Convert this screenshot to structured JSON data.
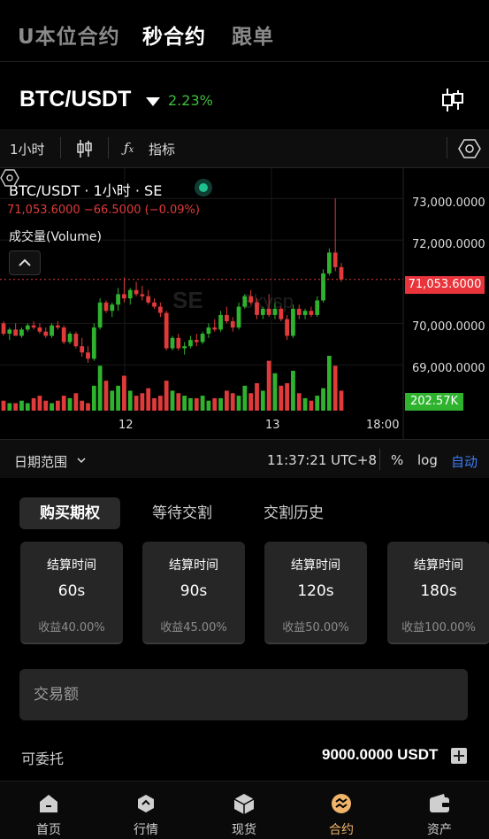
{
  "top_tabs": [
    {
      "label": "U本位合约"
    },
    {
      "label": "秒合约"
    },
    {
      "label": "跟单"
    }
  ],
  "pair": {
    "name": "BTC/USDT",
    "change": "2.23%",
    "change_color": "#3cbf3c"
  },
  "toolbar": {
    "interval": "1小时",
    "indicator_label": "指标"
  },
  "chart": {
    "title": "BTC/USDT · 1小时 · SE",
    "price_line": "71,053.6000  −66.5000 (−0.09%)",
    "volume_label": "成交量(Volume)",
    "y_ticks": [
      "73,000.0000",
      "72,000.0000",
      "71,053.6000",
      "70,000.0000",
      "69,000.0000"
    ],
    "current_price": "71,053.6000",
    "current_volume": "202.57K",
    "x_ticks": [
      "12",
      "13",
      "18:00"
    ],
    "up_color": "#2fb32f",
    "down_color": "#e03a3a"
  },
  "chart_data": {
    "type": "candlestick",
    "ylim": [
      68200,
      73600
    ],
    "y_ticks": [
      73000,
      72000,
      71053.6,
      70000,
      69000
    ],
    "x_ticks": [
      "12",
      "13",
      "18:00"
    ],
    "last_price": 71053.6,
    "last_volume": "202.57K",
    "candles": [
      [
        70000,
        70050,
        69700,
        69750
      ],
      [
        69750,
        69900,
        69600,
        69850
      ],
      [
        69850,
        70000,
        69700,
        69700
      ],
      [
        69700,
        69900,
        69650,
        69850
      ],
      [
        69850,
        70000,
        69800,
        69950
      ],
      [
        69950,
        70050,
        69850,
        69900
      ],
      [
        69900,
        70000,
        69750,
        69800
      ],
      [
        69800,
        69900,
        69650,
        69700
      ],
      [
        69700,
        70000,
        69650,
        69950
      ],
      [
        69950,
        70050,
        69850,
        69900
      ],
      [
        69900,
        69950,
        69500,
        69550
      ],
      [
        69550,
        69800,
        69500,
        69750
      ],
      [
        69750,
        69800,
        69400,
        69450
      ],
      [
        69450,
        69650,
        69200,
        69300
      ],
      [
        69300,
        69450,
        69050,
        69150
      ],
      [
        69150,
        70000,
        69100,
        69900
      ],
      [
        69900,
        70600,
        69850,
        70500
      ],
      [
        70500,
        70550,
        70250,
        70300
      ],
      [
        70300,
        70500,
        70150,
        70450
      ],
      [
        70450,
        70850,
        70300,
        70700
      ],
      [
        70700,
        71100,
        70500,
        70600
      ],
      [
        70600,
        70850,
        70450,
        70800
      ],
      [
        70800,
        71000,
        70650,
        70700
      ],
      [
        70700,
        70900,
        70550,
        70650
      ],
      [
        70650,
        70800,
        70450,
        70500
      ],
      [
        70500,
        70600,
        70350,
        70400
      ],
      [
        70400,
        70500,
        70150,
        70250
      ],
      [
        70250,
        70300,
        69350,
        69400
      ],
      [
        69400,
        69700,
        69350,
        69650
      ],
      [
        69650,
        69750,
        69350,
        69400
      ],
      [
        69400,
        69550,
        69250,
        69450
      ],
      [
        69450,
        69700,
        69400,
        69600
      ],
      [
        69600,
        69750,
        69450,
        69550
      ],
      [
        69550,
        69800,
        69500,
        69750
      ],
      [
        69750,
        70000,
        69650,
        69900
      ],
      [
        69900,
        70100,
        69800,
        69850
      ],
      [
        69850,
        70300,
        69800,
        70200
      ],
      [
        70200,
        70400,
        70000,
        70050
      ],
      [
        70050,
        70150,
        69800,
        69900
      ],
      [
        69900,
        70500,
        69850,
        70400
      ],
      [
        70400,
        70700,
        70350,
        70650
      ],
      [
        70650,
        70800,
        70450,
        70500
      ],
      [
        70500,
        70600,
        70100,
        70200
      ],
      [
        70200,
        70400,
        70100,
        70350
      ],
      [
        70350,
        70700,
        70150,
        70200
      ],
      [
        70200,
        70500,
        70100,
        70350
      ],
      [
        70350,
        70400,
        70050,
        70100
      ],
      [
        70100,
        70200,
        69600,
        69700
      ],
      [
        69700,
        70450,
        69650,
        70350
      ],
      [
        70350,
        70450,
        70100,
        70200
      ],
      [
        70200,
        70350,
        70100,
        70300
      ],
      [
        70300,
        70400,
        70150,
        70200
      ],
      [
        70200,
        70650,
        70150,
        70550
      ],
      [
        70550,
        71300,
        70500,
        71200
      ],
      [
        71200,
        71800,
        71150,
        71700
      ],
      [
        71700,
        73000,
        71250,
        71350
      ],
      [
        71350,
        71450,
        71000,
        71053.6
      ]
    ],
    "volumes": [
      4,
      3,
      3,
      4,
      3,
      5,
      6,
      4,
      3,
      4,
      6,
      5,
      7,
      4,
      3,
      10,
      18,
      12,
      8,
      10,
      14,
      8,
      6,
      7,
      9,
      5,
      6,
      12,
      8,
      7,
      6,
      5,
      5,
      6,
      4,
      5,
      5,
      8,
      7,
      6,
      10,
      7,
      11,
      8,
      20,
      15,
      10,
      11,
      16,
      7,
      5,
      4,
      6,
      9,
      22,
      18,
      8
    ]
  },
  "date_row": {
    "range_label": "日期范围",
    "time": "11:37:21 UTC+8",
    "percent": "%",
    "log": "log",
    "auto": "自动",
    "auto_color": "#3d7cf5"
  },
  "option_tabs": [
    {
      "label": "购买期权"
    },
    {
      "label": "等待交割"
    },
    {
      "label": "交割历史"
    }
  ],
  "cards": [
    {
      "label": "结算时间",
      "duration": "60s",
      "yield": "收益40.00%"
    },
    {
      "label": "结算时间",
      "duration": "90s",
      "yield": "收益45.00%"
    },
    {
      "label": "结算时间",
      "duration": "120s",
      "yield": "收益50.00%"
    },
    {
      "label": "结算时间",
      "duration": "180s",
      "yield": "收益100.00%"
    }
  ],
  "amount": {
    "placeholder": "交易额",
    "value": ""
  },
  "available": {
    "label": "可委托",
    "value": "9000.0000 USDT"
  },
  "bottom_nav": [
    {
      "label": "首页",
      "icon": "home-icon"
    },
    {
      "label": "行情",
      "icon": "market-icon"
    },
    {
      "label": "现货",
      "icon": "spot-icon"
    },
    {
      "label": "合约",
      "icon": "contract-icon"
    },
    {
      "label": "资产",
      "icon": "wallet-icon"
    }
  ]
}
